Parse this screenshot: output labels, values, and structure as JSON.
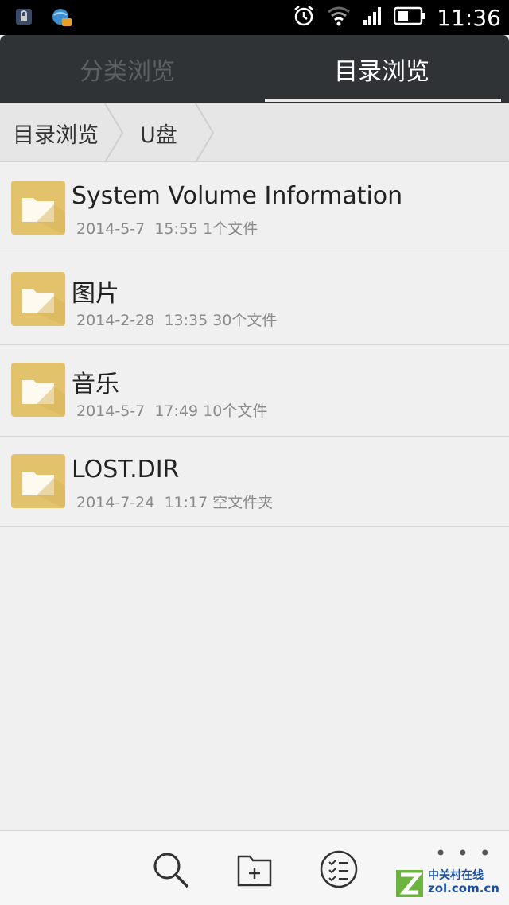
{
  "status_bar": {
    "time": "11:36",
    "icons": [
      "lock-app-icon",
      "vpn-app-icon",
      "alarm-icon",
      "wifi-icon",
      "signal-icon",
      "battery-icon"
    ]
  },
  "tabs": [
    {
      "label": "分类浏览",
      "active": false
    },
    {
      "label": "目录浏览",
      "active": true
    }
  ],
  "breadcrumb": [
    "目录浏览",
    "U盘"
  ],
  "files": [
    {
      "name": "System  Volume  Information",
      "date": "2014-5-7",
      "time": "15:55",
      "info": "1个文件"
    },
    {
      "name": "图片",
      "date": "2014-2-28",
      "time": "13:35",
      "info": "30个文件"
    },
    {
      "name": "音乐",
      "date": "2014-5-7",
      "time": "17:49",
      "info": "10个文件"
    },
    {
      "name": "LOST.DIR",
      "date": "2014-7-24",
      "time": "11:17",
      "info": "空文件夹"
    }
  ],
  "toolbar": {
    "icons": [
      "search-icon",
      "new-folder-icon",
      "multi-select-icon",
      "more-icon"
    ],
    "more_label": "• • •"
  },
  "watermark": {
    "line1": "中关村在线",
    "line2": "zol.com.cn"
  },
  "colors": {
    "tab_bg": "#2f3336",
    "folder": "#e2c26a",
    "watermark": "#1a4fa0"
  }
}
